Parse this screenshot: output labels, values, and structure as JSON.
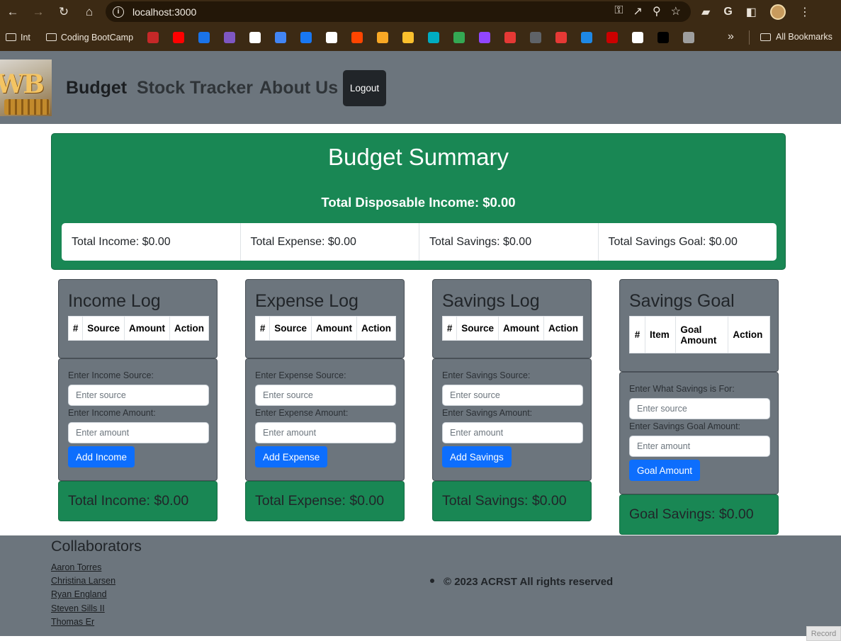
{
  "browser": {
    "url": "localhost:3000",
    "bookmarks": [
      {
        "label": "Int"
      },
      {
        "label": "Coding BootCamp"
      }
    ],
    "favicon_colors": [
      "#c62828",
      "#ff0000",
      "#1a73e8",
      "#7e57c2",
      "#ffffff",
      "#4285f4",
      "#1877f2",
      "#ffffff",
      "#ff4500",
      "#f9a825",
      "#fbc02d",
      "#00acc1",
      "#34a853",
      "#9146ff",
      "#e53935",
      "#5f6368",
      "#e53935",
      "#1e88e5",
      "#cc0000",
      "#ffffff",
      "#000000",
      "#9e9e9e"
    ],
    "all_bookmarks_label": "All Bookmarks"
  },
  "navbar": {
    "logo_text": "WB",
    "links": [
      "Budget",
      "Stock Tracker",
      "About Us"
    ],
    "logout_label": "Logout"
  },
  "summary": {
    "title": "Budget Summary",
    "disposable": "Total Disposable Income: $0.00",
    "cells": [
      "Total Income: $0.00",
      "Total Expense: $0.00",
      "Total Savings: $0.00",
      "Total Savings Goal: $0.00"
    ]
  },
  "logs": [
    {
      "title": "Income Log",
      "headers": [
        "#",
        "Source",
        "Amount",
        "Action"
      ],
      "label_1": "Enter Income Source:",
      "placeholder_1": "Enter source",
      "label_2": "Enter Income Amount:",
      "placeholder_2": "Enter amount",
      "button": "Add Income",
      "total": "Total Income: $0.00"
    },
    {
      "title": "Expense Log",
      "headers": [
        "#",
        "Source",
        "Amount",
        "Action"
      ],
      "label_1": "Enter Expense Source:",
      "placeholder_1": "Enter source",
      "label_2": "Enter Expense Amount:",
      "placeholder_2": "Enter amount",
      "button": "Add Expense",
      "total": "Total Expense: $0.00"
    },
    {
      "title": "Savings Log",
      "headers": [
        "#",
        "Source",
        "Amount",
        "Action"
      ],
      "label_1": "Enter Savings Source:",
      "placeholder_1": "Enter source",
      "label_2": "Enter Savings Amount:",
      "placeholder_2": "Enter amount",
      "button": "Add Savings",
      "total": "Total Savings: $0.00"
    },
    {
      "title": "Savings Goal",
      "headers": [
        "#",
        "Item",
        "Goal Amount",
        "Action"
      ],
      "label_1": "Enter What Savings is For:",
      "placeholder_1": "Enter source",
      "label_2": "Enter Savings Goal Amount:",
      "placeholder_2": "Enter amount",
      "button": "Goal Amount",
      "total": "Goal Savings: $0.00"
    }
  ],
  "footer": {
    "collaborators_title": "Collaborators",
    "collaborators": [
      "Aaron Torres",
      "Christina Larsen",
      "Ryan England",
      "Steven Sills II",
      "Thomas Er"
    ],
    "copyright": "© 2023 ACRST All rights reserved"
  },
  "record_label": "Record",
  "colors": {
    "navbar_bg": "#6c757d",
    "success_green": "#198754",
    "primary_blue": "#0d6efd",
    "dark_button": "#212529"
  }
}
